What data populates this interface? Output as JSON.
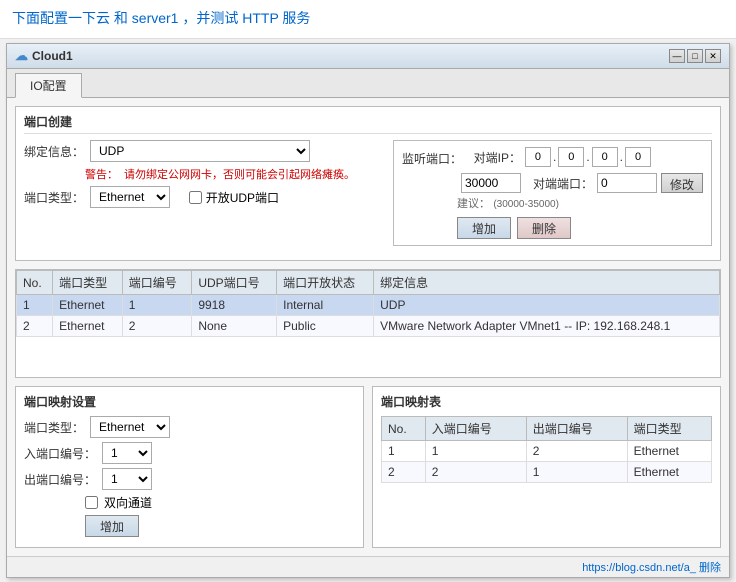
{
  "header": {
    "text": "下面配置一下云 和 server1 ，并测试 HTTP 服务"
  },
  "window": {
    "title": "Cloud1",
    "icon": "☁",
    "controls": [
      "—",
      "□",
      "✕"
    ]
  },
  "tabs": [
    {
      "label": "IO配置",
      "active": true
    }
  ],
  "port_creation": {
    "section_title": "端口创建",
    "bind_label": "绑定信息：",
    "bind_value": "UDP",
    "warning": "请勿绑定公网网卡，否则可能会引起网络瘫痪。",
    "port_type_label": "端口类型：",
    "port_type_value": "Ethernet",
    "open_udp_label": "开放UDP端口",
    "listen_port_label": "监听端口：",
    "listen_port_value": "30000",
    "hint": "(30000-35000)",
    "suggest_label": "建议：",
    "peer_ip_label": "对端IP：",
    "ip_segments": [
      "0",
      "0",
      "0",
      "0"
    ],
    "peer_port_label": "对端端口：",
    "peer_port_value": "0",
    "modify_btn": "修改",
    "add_btn": "增加",
    "delete_btn": "删除"
  },
  "port_table": {
    "columns": [
      "No.",
      "端口类型",
      "端口编号",
      "UDP端口号",
      "端口开放状态",
      "绑定信息"
    ],
    "rows": [
      {
        "no": "1",
        "type": "Ethernet",
        "number": "1",
        "udp": "9918",
        "status": "Internal",
        "bind": "UDP"
      },
      {
        "no": "2",
        "type": "Ethernet",
        "number": "2",
        "udp": "None",
        "status": "Public",
        "bind": "VMware Network Adapter VMnet1 -- IP: 192.168.248.1"
      }
    ]
  },
  "port_mapping_settings": {
    "title": "端口映射设置",
    "port_type_label": "端口类型：",
    "port_type_value": "Ethernet",
    "in_port_label": "入端口编号：",
    "in_port_value": "1",
    "out_port_label": "出端口编号：",
    "out_port_value": "1",
    "bidirectional_label": "双向通道",
    "add_btn": "增加"
  },
  "port_mapping_table": {
    "title": "端口映射表",
    "columns": [
      "No.",
      "入端口编号",
      "出端口编号",
      "端口类型"
    ],
    "rows": [
      {
        "no": "1",
        "in": "1",
        "out": "2",
        "type": "Ethernet"
      },
      {
        "no": "2",
        "in": "2",
        "out": "1",
        "type": "Ethernet"
      }
    ]
  },
  "status_bar": {
    "url": "https://blog.csdn.net/a_                    删除"
  }
}
